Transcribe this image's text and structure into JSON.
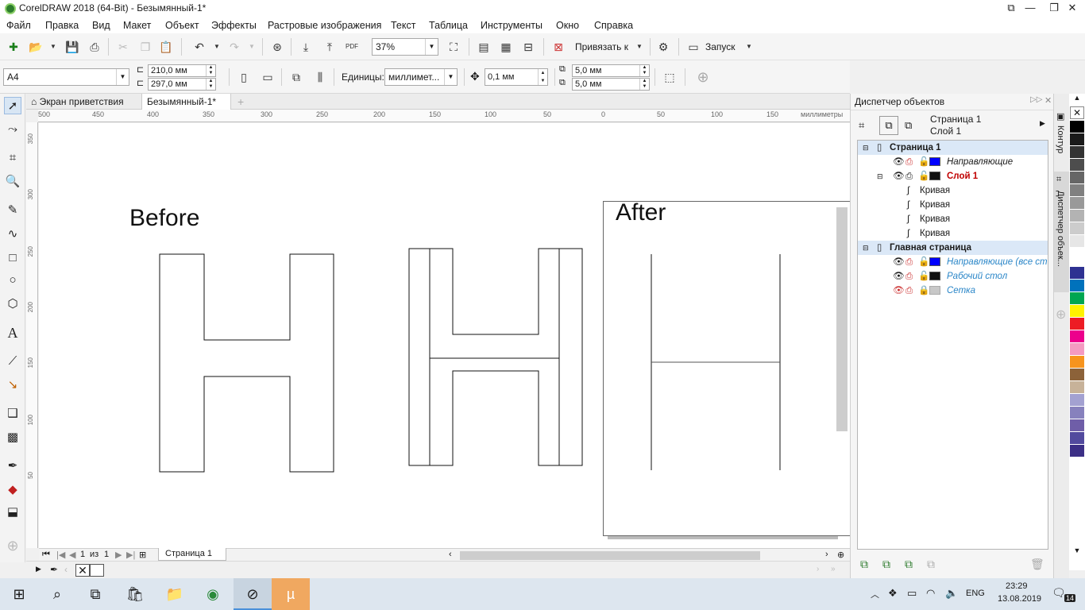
{
  "window": {
    "title": "CorelDRAW 2018 (64-Bit) - Безымянный-1*",
    "minimize": "—",
    "maximize": "❐",
    "close": "✕"
  },
  "menu": [
    "Файл",
    "Правка",
    "Вид",
    "Макет",
    "Объект",
    "Эффекты",
    "Растровые изображения",
    "Текст",
    "Таблица",
    "Инструменты",
    "Окно",
    "Справка"
  ],
  "toolbar": {
    "zoom": "37%",
    "snap": "Привязать к",
    "launch": "Запуск"
  },
  "propbar": {
    "paper": "A4",
    "width": "210,0 мм",
    "height": "297,0 мм",
    "units_label": "Единицы:",
    "units": "миллимет...",
    "nudge": "0,1 мм",
    "dup_x": "5,0 мм",
    "dup_y": "5,0 мм"
  },
  "tabs": {
    "welcome": "Экран приветствия",
    "document": "Безымянный-1*"
  },
  "ruler": {
    "units": "миллиметры",
    "h_ticks": [
      "500",
      "450",
      "400",
      "350",
      "300",
      "250",
      "200",
      "150",
      "100",
      "50",
      "0",
      "50",
      "100",
      "150"
    ],
    "v_ticks": [
      "350",
      "300",
      "250",
      "200",
      "150",
      "100",
      "50"
    ]
  },
  "canvas": {
    "before": "Before",
    "after": "After"
  },
  "pagenav": {
    "current": "1",
    "of": "из",
    "total": "1",
    "page_tab": "Страница 1"
  },
  "docker": {
    "title": "Диспетчер объектов",
    "page": "Страница 1",
    "layer": "Слой 1",
    "tree": [
      {
        "label": "Страница 1",
        "style": "bold",
        "indent": 0
      },
      {
        "label": "Направляющие",
        "style": "italic",
        "indent": 2,
        "color": "#0000ff"
      },
      {
        "label": "Слой 1",
        "style": "bold-red",
        "indent": 1,
        "color": "#111111"
      },
      {
        "label": "Кривая",
        "style": "normal",
        "indent": 3
      },
      {
        "label": "Кривая",
        "style": "normal",
        "indent": 3
      },
      {
        "label": "Кривая",
        "style": "normal",
        "indent": 3
      },
      {
        "label": "Кривая",
        "style": "normal",
        "indent": 3
      },
      {
        "label": "Главная страница",
        "style": "bold",
        "indent": 0
      },
      {
        "label": "Направляющие (все ст",
        "style": "italic-blue",
        "indent": 2,
        "color": "#0000ff"
      },
      {
        "label": "Рабочий стол",
        "style": "italic-blue",
        "indent": 2,
        "color": "#111111"
      },
      {
        "label": "Сетка",
        "style": "italic-blue",
        "indent": 2,
        "color": "#c8c8c8"
      }
    ]
  },
  "sidetabs": {
    "contour": "Контур",
    "objmgr": "Диспетчер объек..."
  },
  "palette": [
    "#000000",
    "#1a1a1a",
    "#333333",
    "#4d4d4d",
    "#666666",
    "#808080",
    "#999999",
    "#b3b3b3",
    "#cccccc",
    "#e6e6e6",
    "#ffffff",
    "#2e3192",
    "#0072bc",
    "#00a651",
    "#fff200",
    "#ed1c24",
    "#ec008c",
    "#f49ac1",
    "#f7941d",
    "#8c6239",
    "#c7b299",
    "#a3a1d1",
    "#8781bd",
    "#6f5ea8",
    "#524a9e",
    "#3c2f86"
  ],
  "taskbar": {
    "lang": "ENG",
    "time": "23:29",
    "date": "13.08.2019",
    "notif": "14"
  }
}
